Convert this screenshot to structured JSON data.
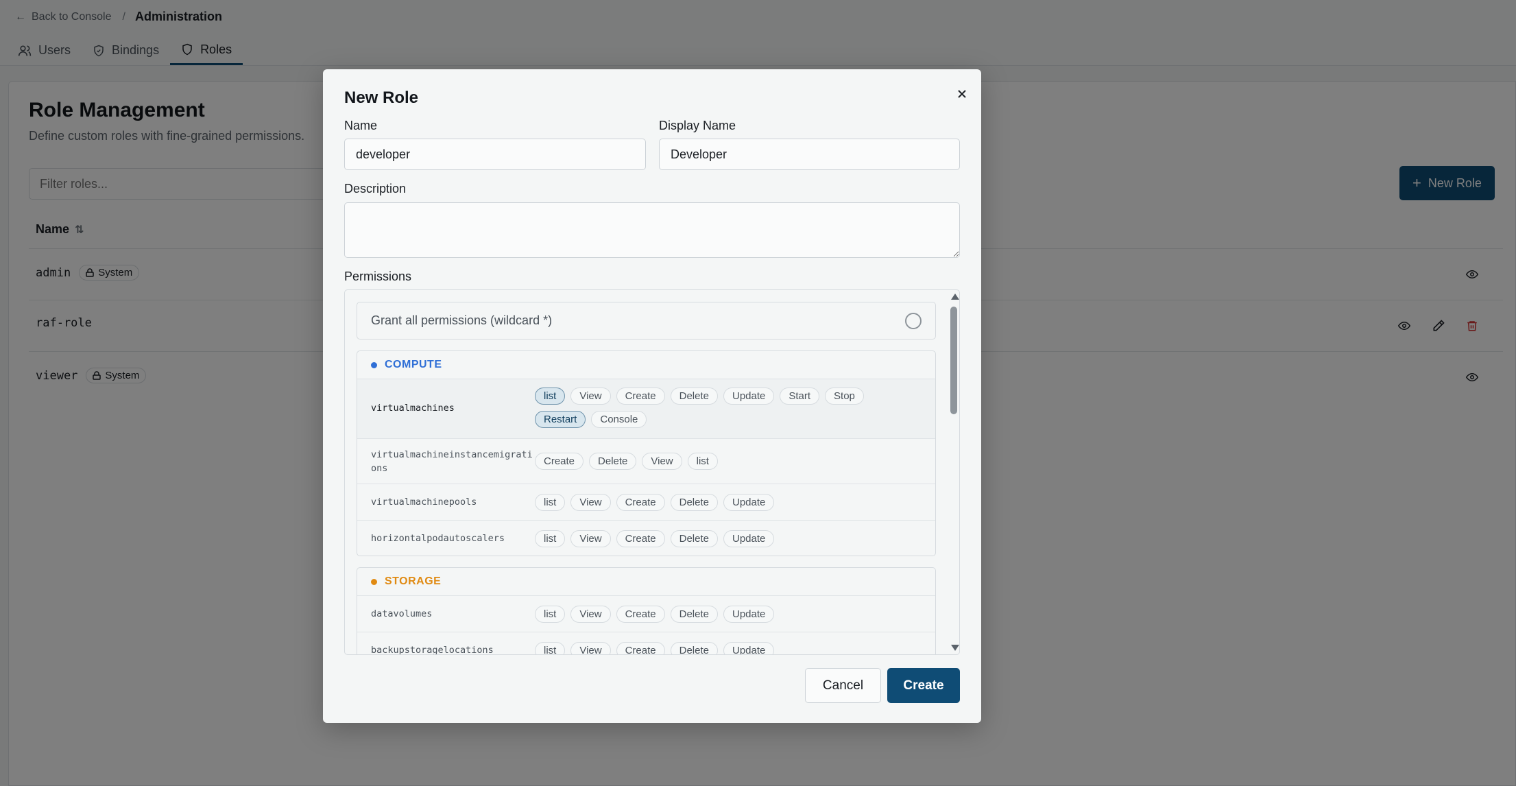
{
  "breadcrumb": {
    "back_label": "Back to Console",
    "separator": "/",
    "current": "Administration"
  },
  "tabs": [
    {
      "label": "Users",
      "icon": "users-icon"
    },
    {
      "label": "Bindings",
      "icon": "shield-icon"
    },
    {
      "label": "Roles",
      "icon": "shield-icon",
      "active": true
    }
  ],
  "page": {
    "title": "Role Management",
    "subtitle": "Define custom roles with fine-grained permissions.",
    "filter_placeholder": "Filter roles...",
    "new_role_label": "New Role",
    "column_name": "Name",
    "rows": [
      {
        "name": "admin",
        "badge": "System"
      },
      {
        "name": "raf-role",
        "badge": ""
      },
      {
        "name": "viewer",
        "badge": "System"
      }
    ]
  },
  "modal": {
    "title": "New Role",
    "name_label": "Name",
    "name_value": "developer",
    "display_label": "Display Name",
    "display_value": "Developer",
    "description_label": "Description",
    "description_value": "",
    "permissions_label": "Permissions",
    "wildcard_label": "Grant all permissions (wildcard *)",
    "groups": [
      {
        "title": "COMPUTE",
        "color": "#2f6fd6",
        "resources": [
          {
            "name": "virtualmachines",
            "verbs": [
              {
                "label": "list",
                "selected": true
              },
              {
                "label": "View"
              },
              {
                "label": "Create"
              },
              {
                "label": "Delete"
              },
              {
                "label": "Update"
              },
              {
                "label": "Start"
              },
              {
                "label": "Stop"
              },
              {
                "label": "Restart",
                "selected": true
              },
              {
                "label": "Console"
              }
            ]
          },
          {
            "name": "virtualmachineinstancemigrations",
            "verbs": [
              {
                "label": "Create"
              },
              {
                "label": "Delete"
              },
              {
                "label": "View"
              },
              {
                "label": "list"
              }
            ]
          },
          {
            "name": "virtualmachinepools",
            "verbs": [
              {
                "label": "list"
              },
              {
                "label": "View"
              },
              {
                "label": "Create"
              },
              {
                "label": "Delete"
              },
              {
                "label": "Update"
              }
            ]
          },
          {
            "name": "horizontalpodautoscalers",
            "verbs": [
              {
                "label": "list"
              },
              {
                "label": "View"
              },
              {
                "label": "Create"
              },
              {
                "label": "Delete"
              },
              {
                "label": "Update"
              }
            ]
          }
        ]
      },
      {
        "title": "STORAGE",
        "color": "#e08a12",
        "resources": [
          {
            "name": "datavolumes",
            "verbs": [
              {
                "label": "list"
              },
              {
                "label": "View"
              },
              {
                "label": "Create"
              },
              {
                "label": "Delete"
              },
              {
                "label": "Update"
              }
            ]
          },
          {
            "name": "backupstoragelocations",
            "verbs": [
              {
                "label": "list"
              },
              {
                "label": "View"
              },
              {
                "label": "Create"
              },
              {
                "label": "Delete"
              },
              {
                "label": "Update"
              }
            ]
          }
        ]
      }
    ],
    "cancel_label": "Cancel",
    "create_label": "Create"
  }
}
